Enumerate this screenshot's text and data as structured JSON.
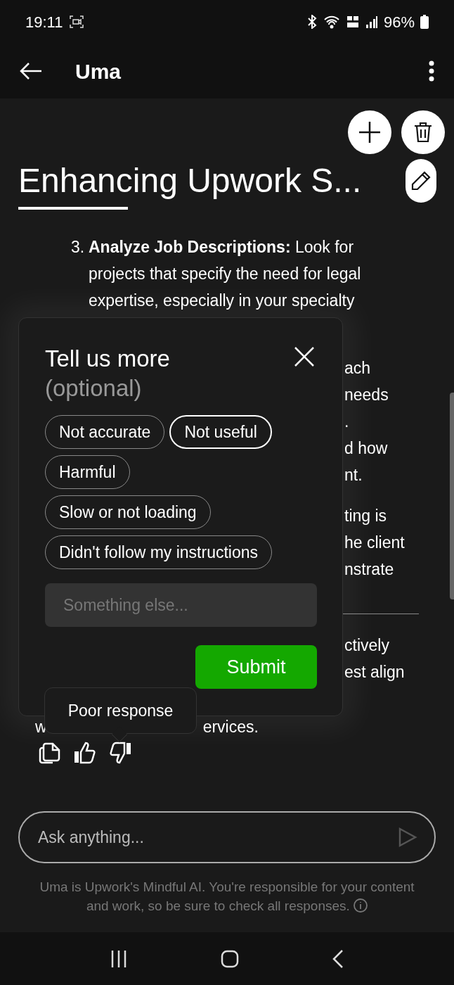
{
  "status_bar": {
    "time": "19:11",
    "battery": "96%"
  },
  "app_bar": {
    "title": "Uma"
  },
  "conversation": {
    "title": "Enhancing Upwork S...",
    "list_item": {
      "number": "3.",
      "lines": [
        "**Analyze Job Descriptions:** Look for",
        "projects that specify the need for legal",
        "expertise, especially in your specialty"
      ]
    },
    "fragments_before_rule": [
      [
        "ach",
        "needs",
        ".",
        "d how",
        "nt."
      ],
      [
        "ting is",
        "he client",
        "nstrate"
      ]
    ],
    "fragments_after_rule": [
      "ctively",
      "est align"
    ],
    "last_line": {
      "start": "w",
      "end": "ervices."
    }
  },
  "feedback_popover": {
    "title": "Tell us more",
    "subtitle": "(optional)",
    "chips": [
      {
        "label": "Not accurate",
        "selected": false
      },
      {
        "label": "Not useful",
        "selected": true
      },
      {
        "label": "Harmful",
        "selected": false
      },
      {
        "label": "Slow or not loading",
        "selected": false
      },
      {
        "label": "Didn't follow my instructions",
        "selected": false
      }
    ],
    "input": {
      "placeholder": "Something else..."
    },
    "submit": "Submit"
  },
  "tooltip": "Poor response",
  "message_actions": [
    {
      "kind": "copy"
    },
    {
      "kind": "thumbs_up"
    },
    {
      "kind": "thumbs_down"
    }
  ],
  "composer": {
    "placeholder": "Ask anything..."
  },
  "disclaimer": "Uma is Upwork's Mindful AI. You're responsible for your content and work, so be sure to check all responses."
}
